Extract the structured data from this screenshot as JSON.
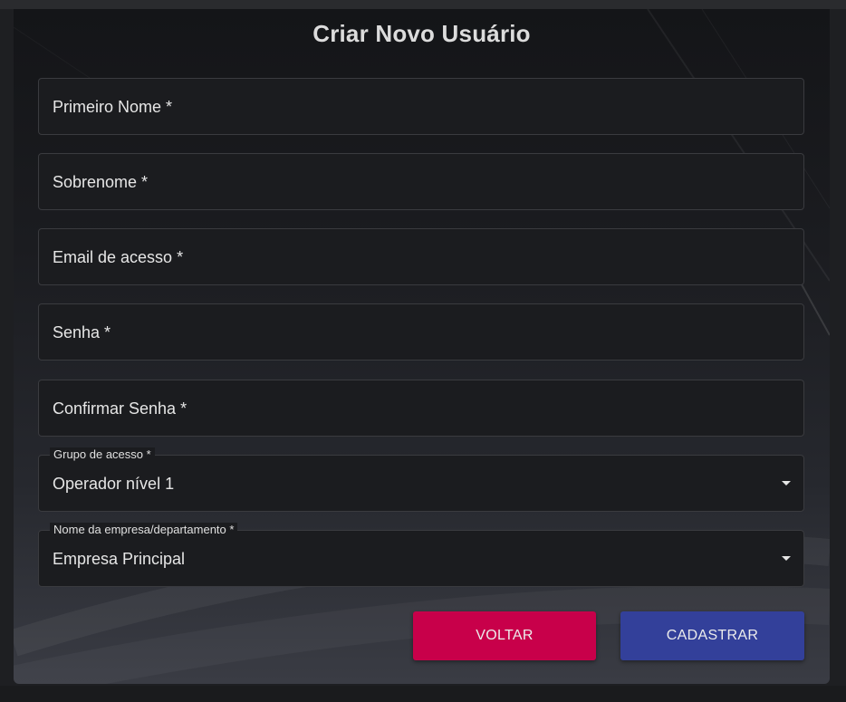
{
  "form": {
    "title": "Criar Novo Usuário",
    "fields": {
      "first_name": {
        "label": "Primeiro Nome *"
      },
      "last_name": {
        "label": "Sobrenome *"
      },
      "email": {
        "label": "Email de acesso *"
      },
      "password": {
        "label": "Senha *"
      },
      "confirm_password": {
        "label": "Confirmar Senha *"
      },
      "access_group": {
        "label": "Grupo de acesso *",
        "value": "Operador nível 1"
      },
      "company": {
        "label": "Nome da empresa/departamento *",
        "value": "Empresa Principal"
      }
    },
    "buttons": {
      "back": "VOLTAR",
      "submit": "CADASTRAR"
    }
  },
  "colors": {
    "back_button": "#c8004a",
    "submit_button": "#33409a",
    "field_background": "#1b1c1f"
  },
  "icons": {
    "dropdown": "triangle-down-icon"
  }
}
